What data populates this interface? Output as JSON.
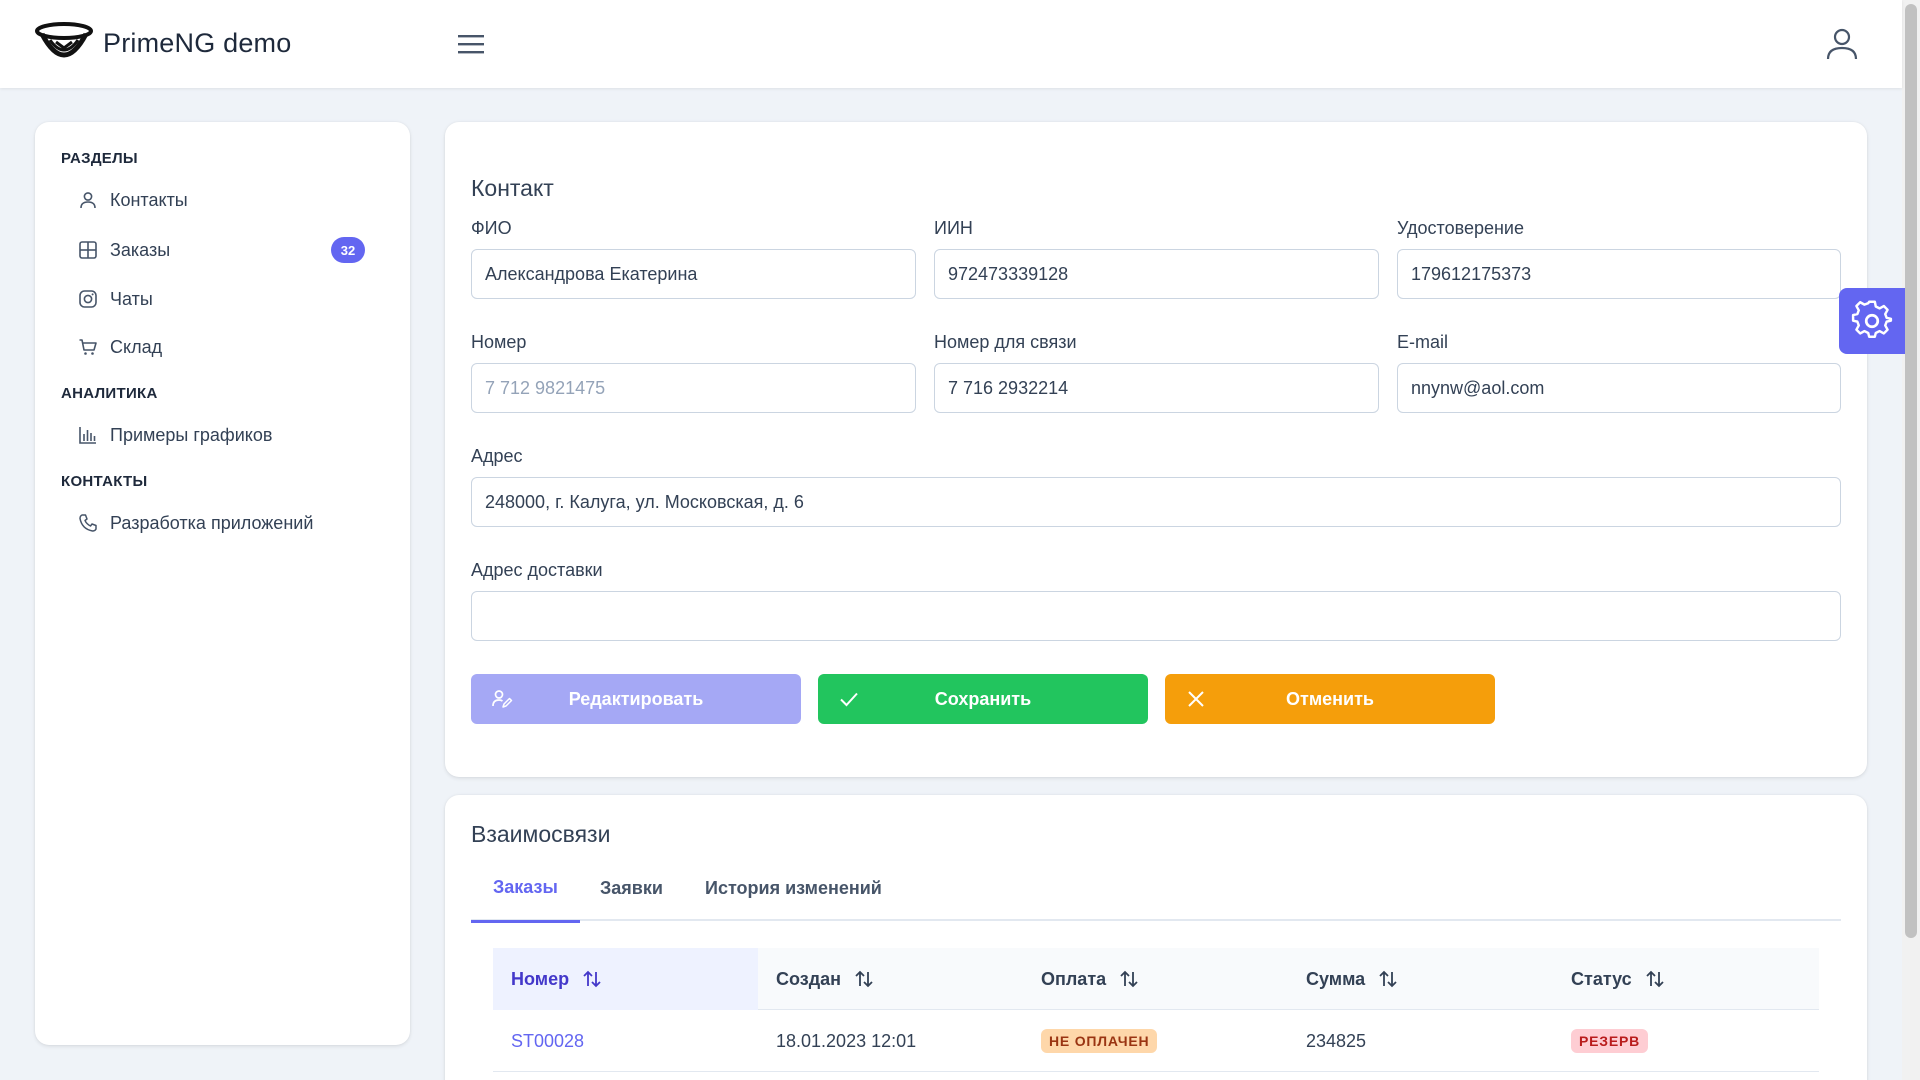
{
  "app": {
    "brand": "PrimeNG demo"
  },
  "sidebar": {
    "sections": [
      {
        "title": "РАЗДЕЛЫ"
      },
      {
        "title": "АНАЛИТИКА"
      },
      {
        "title": "КОНТАКТЫ"
      }
    ],
    "items": [
      {
        "label": "Контакты",
        "icon": "user-icon"
      },
      {
        "label": "Заказы",
        "icon": "table-icon",
        "badge": "32"
      },
      {
        "label": "Чаты",
        "icon": "instagram-icon"
      },
      {
        "label": "Склад",
        "icon": "cart-icon"
      },
      {
        "label": "Примеры графиков",
        "icon": "chart-bar-icon"
      },
      {
        "label": "Разработка приложений",
        "icon": "phone-icon"
      }
    ]
  },
  "contact": {
    "title": "Контакт",
    "fields": {
      "fio": {
        "label": "ФИО",
        "value": "Александрова Екатерина"
      },
      "iin": {
        "label": "ИИН",
        "value": "972473339128"
      },
      "id_card": {
        "label": "Удостоверение",
        "value": "179612175373"
      },
      "number": {
        "label": "Номер",
        "value": "7 712 9821475"
      },
      "contact_number": {
        "label": "Номер для связи",
        "value": "7 716 2932214"
      },
      "email": {
        "label": "E-mail",
        "value": "nnynw@aol.com"
      },
      "address": {
        "label": "Адрес",
        "value": "248000, г. Калуга, ул. Московская, д. 6"
      },
      "delivery_address": {
        "label": "Адрес доставки",
        "value": ""
      }
    },
    "buttons": {
      "edit": "Редактировать",
      "save": "Сохранить",
      "cancel": "Отменить"
    }
  },
  "relations": {
    "title": "Взаимосвязи",
    "tabs": [
      "Заказы",
      "Заявки",
      "История изменений"
    ],
    "active_tab": "Заказы",
    "table": {
      "columns": [
        "Номер",
        "Создан",
        "Оплата",
        "Сумма",
        "Статус"
      ],
      "rows": [
        {
          "number": "ST00028",
          "created": "18.01.2023 12:01",
          "payment": "НЕ ОПЛАЧЕН",
          "sum": "234825",
          "status": "РЕЗЕРВ"
        }
      ]
    }
  },
  "colors": {
    "accent": "#6366f1",
    "success": "#22c55e",
    "warning": "#f59e0b",
    "edit_disabled": "#a5a8f5"
  }
}
